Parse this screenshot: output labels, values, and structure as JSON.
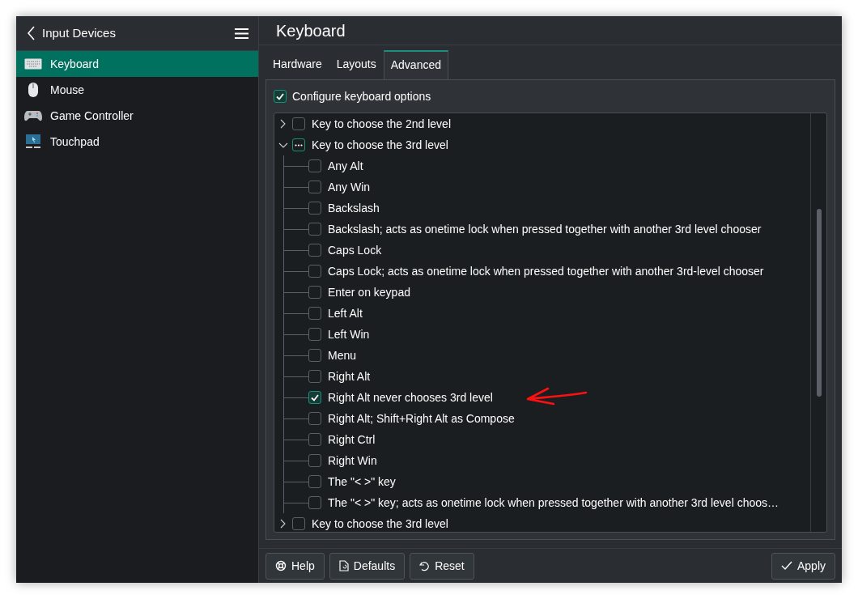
{
  "sidebar": {
    "title": "Input Devices",
    "items": [
      {
        "label": "Keyboard",
        "kind": "keyboard",
        "selected": true
      },
      {
        "label": "Mouse",
        "kind": "mouse",
        "selected": false
      },
      {
        "label": "Game Controller",
        "kind": "gamepad",
        "selected": false
      },
      {
        "label": "Touchpad",
        "kind": "touchpad",
        "selected": false
      }
    ]
  },
  "page_title": "Keyboard",
  "tabs": [
    {
      "label": "Hardware",
      "selected": false
    },
    {
      "label": "Layouts",
      "selected": false
    },
    {
      "label": "Advanced",
      "selected": true
    }
  ],
  "configure_option": {
    "label": "Configure keyboard options",
    "checked": true
  },
  "options_tree": [
    {
      "label": "Key to choose the 2nd level",
      "expanded": false,
      "partial": false
    },
    {
      "label": "Key to choose the 3rd level",
      "expanded": true,
      "partial": true,
      "children": [
        {
          "label": "Any Alt",
          "checked": false
        },
        {
          "label": "Any Win",
          "checked": false
        },
        {
          "label": "Backslash",
          "checked": false
        },
        {
          "label": "Backslash; acts as onetime lock when pressed together with another 3rd level chooser",
          "checked": false
        },
        {
          "label": "Caps Lock",
          "checked": false
        },
        {
          "label": "Caps Lock; acts as onetime lock when pressed together with another 3rd-level chooser",
          "checked": false
        },
        {
          "label": "Enter on keypad",
          "checked": false
        },
        {
          "label": "Left Alt",
          "checked": false
        },
        {
          "label": "Left Win",
          "checked": false
        },
        {
          "label": "Menu",
          "checked": false
        },
        {
          "label": "Right Alt",
          "checked": false
        },
        {
          "label": "Right Alt never chooses 3rd level",
          "checked": true
        },
        {
          "label": "Right Alt; Shift+Right Alt as Compose",
          "checked": false
        },
        {
          "label": "Right Ctrl",
          "checked": false
        },
        {
          "label": "Right Win",
          "checked": false
        },
        {
          "label": "The \"< >\" key",
          "checked": false
        },
        {
          "label": "The \"< >\" key; acts as onetime lock when pressed together with another 3rd level choos…",
          "checked": false
        }
      ]
    },
    {
      "label": "Key to choose the 3rd level",
      "expanded": false,
      "partial": false
    }
  ],
  "buttons": [
    {
      "label": "Help",
      "kind": "help"
    },
    {
      "label": "Defaults",
      "kind": "defaults"
    },
    {
      "label": "Reset",
      "kind": "reset"
    },
    {
      "label": "Apply",
      "kind": "apply"
    }
  ]
}
